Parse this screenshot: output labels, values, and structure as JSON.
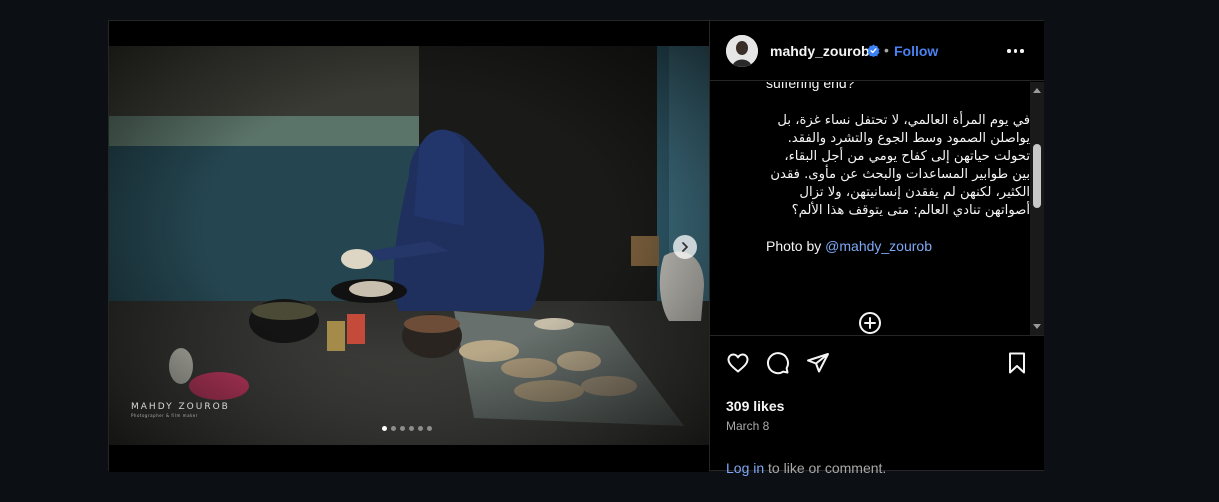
{
  "post": {
    "username": "mahdy_zourob",
    "separator": "•",
    "follow_label": "Follow",
    "watermark": "MAHDY ZOUROB",
    "watermark_sub": "Photographer & film maker",
    "carousel": {
      "count": 6,
      "active": 0
    },
    "caption_en_tail": "suffering end?",
    "caption_ar": "في يوم المرأة العالمي، لا تحتفل نساء غزة، بل يواصلن الصمود وسط الجوع والتشرد والفقد. تحولت حياتهن إلى كفاح يومي من أجل البقاء، بين طوابير المساعدات والبحث عن مأوى. فقدن الكثير، لكنهن لم يفقدن إنسانيتهن، ولا تزال أصواتهن تنادي العالم: متى يتوقف هذا الألم؟",
    "credit_prefix": "Photo by ",
    "credit_mention": "@mahdy_zourob",
    "likes": "309 likes",
    "date": "March 8",
    "login_link": "Log in",
    "login_suffix": " to like or comment."
  },
  "icons": {
    "verified": "verified-badge-icon",
    "more": "more-options-icon",
    "next": "chevron-right-icon",
    "add": "add-comment-icon",
    "like": "heart-icon",
    "comment": "comment-icon",
    "share": "share-icon",
    "save": "bookmark-icon"
  },
  "colors": {
    "background": "#0c0f14",
    "link": "#4a80f0",
    "mention": "#7ea8f5",
    "verified": "#3b82f6"
  }
}
